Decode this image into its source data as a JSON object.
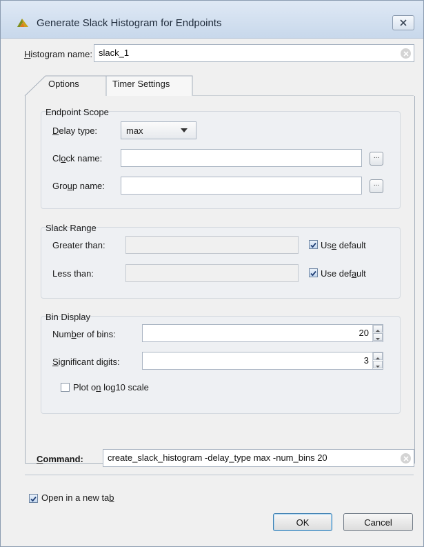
{
  "window": {
    "title": "Generate Slack Histogram for Endpoints"
  },
  "histogram": {
    "label": "Histogram name:",
    "value": "slack_1"
  },
  "tabs": [
    {
      "label": "Options",
      "active": true
    },
    {
      "label": "Timer Settings",
      "active": false
    }
  ],
  "endpoint_scope": {
    "title": "Endpoint Scope",
    "delay_type_label": "Delay type:",
    "delay_type_value": "max",
    "clock_name_label": "Clock name:",
    "clock_name_value": "",
    "group_name_label": "Group name:",
    "group_name_value": "",
    "browse_label": "..."
  },
  "slack_range": {
    "title": "Slack Range",
    "greater_label": "Greater than:",
    "greater_value": "",
    "greater_use_default": "Use default",
    "less_label": "Less than:",
    "less_value": "",
    "less_use_default": "Use default"
  },
  "bin_display": {
    "title": "Bin Display",
    "num_bins_label": "Number of bins:",
    "num_bins_value": "20",
    "sig_digits_label": "Significant digits:",
    "sig_digits_value": "3",
    "log_scale_label": "Plot on log10 scale",
    "log_scale_checked": false
  },
  "command": {
    "label": "Command:",
    "value": "create_slack_histogram -delay_type max -num_bins 20"
  },
  "open_new_tab": {
    "label": "Open in a new tab",
    "checked": true
  },
  "buttons": {
    "ok": "OK",
    "cancel": "Cancel"
  },
  "colors": {
    "accent": "#3c7fb1",
    "title_bar": "#c8d8eb",
    "group_background": "#eef0f3"
  }
}
